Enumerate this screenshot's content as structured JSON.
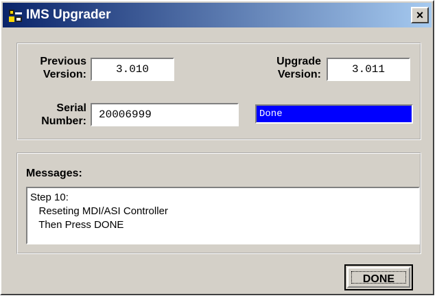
{
  "window": {
    "title": "IMS Upgrader",
    "close_glyph": "×"
  },
  "versions": {
    "previous_label_line1": "Previous",
    "previous_label_line2": "Version:",
    "previous_value": "3.010",
    "upgrade_label_line1": "Upgrade",
    "upgrade_label_line2": "Version:",
    "upgrade_value": "3.011",
    "serial_label_line1": "Serial",
    "serial_label_line2": "Number:",
    "serial_value": "20006999",
    "status": "Done"
  },
  "messages": {
    "label": "Messages:",
    "lines": [
      "Step 10:",
      "   Reseting MDI/ASI Controller",
      "   Then Press DONE"
    ]
  },
  "footer": {
    "done_label": "DONE"
  },
  "colors": {
    "title_start": "#0a246a",
    "title_end": "#a6caf0",
    "status_bg": "#0000ff"
  }
}
